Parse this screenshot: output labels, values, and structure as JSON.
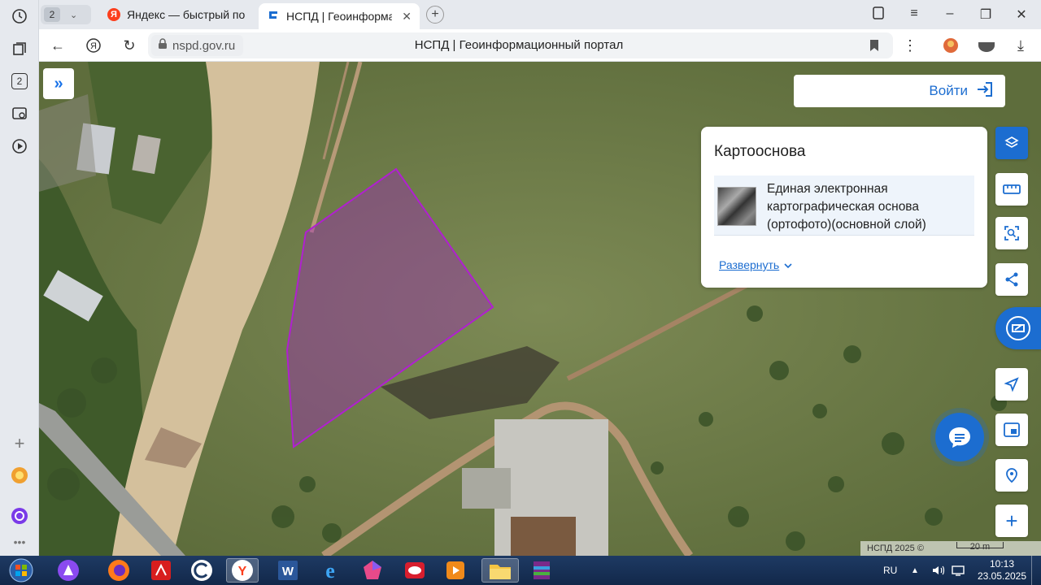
{
  "browser": {
    "tab_count": "2",
    "tabs": [
      {
        "title": "Яндекс — быстрый поиск",
        "favicon": "Я",
        "active": false
      },
      {
        "title": "НСПД | Геоинформаци",
        "favicon": "",
        "active": true
      }
    ],
    "address": {
      "domain": "nspd.gov.ru",
      "page_title": "НСПД | Геоинформационный портал"
    },
    "sidebar_badge": "2"
  },
  "map": {
    "login_label": "Войти",
    "panel": {
      "title": "Картооснова",
      "layer_name": "Единая электронная картографическая основа (ортофото)(основной слой)",
      "expand_label": "Развернуть"
    },
    "copyright": "НСПД 2025 ©",
    "scale_label": "20 m",
    "accent_color": "#1c6dd0",
    "parcel_color": "#a020c0"
  },
  "taskbar": {
    "lang": "RU",
    "time": "10:13",
    "date": "23.05.2025"
  }
}
